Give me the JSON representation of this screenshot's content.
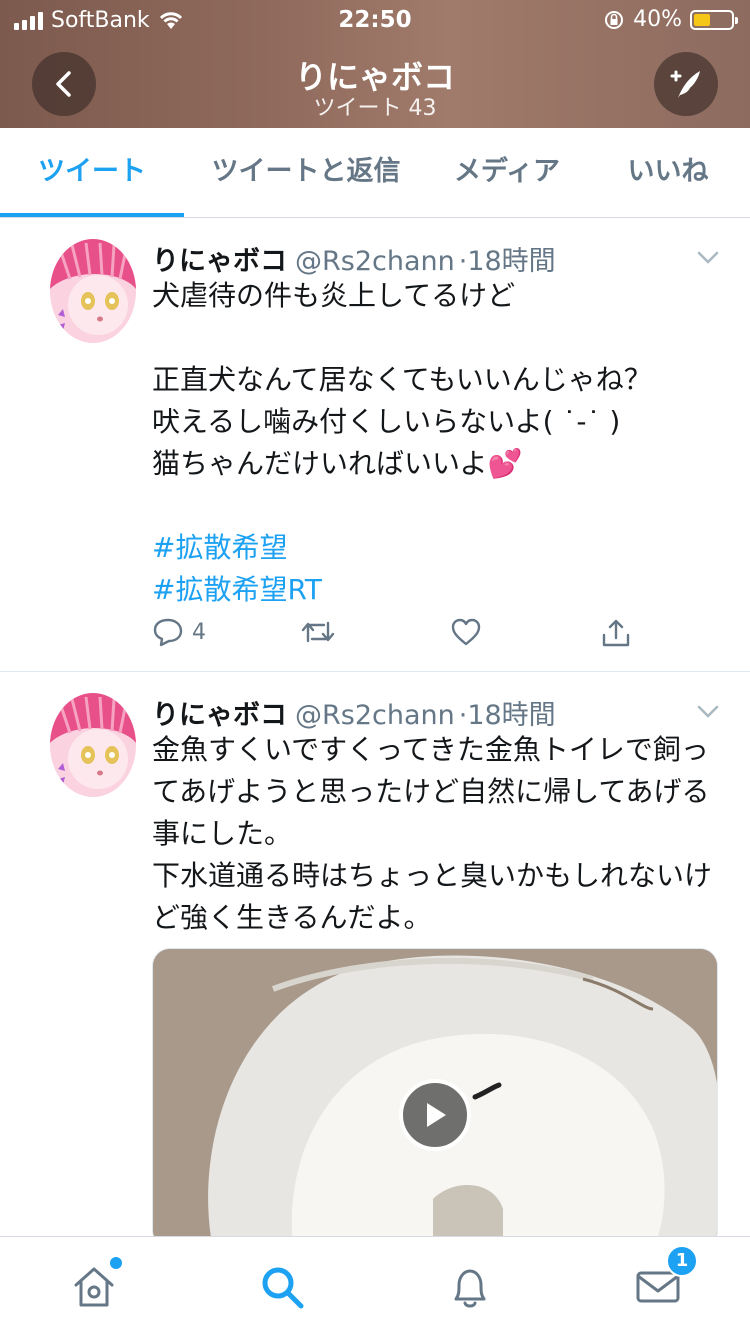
{
  "status_bar": {
    "carrier": "SoftBank",
    "time": "22:50",
    "battery": "40%",
    "battery_level": 0.4
  },
  "header": {
    "title": "りにゃボコ",
    "subtitle": "ツイート 43",
    "back_icon": "chevron-left-icon",
    "compose_icon": "compose-tweet-icon"
  },
  "tabs": [
    {
      "label": "ツイート",
      "active": true
    },
    {
      "label": "ツイートと返信",
      "active": false
    },
    {
      "label": "メディア",
      "active": false
    },
    {
      "label": "いいね",
      "active": false
    }
  ],
  "tweets": [
    {
      "name": "りにゃボコ",
      "handle": "@Rs2chann",
      "time": "·18時間",
      "lines": [
        "犬虐待の件も炎上してるけど",
        "",
        "正直犬なんて居なくてもいいんじゃね？",
        "吠えるし噛み付くしいらないよ( ˙-˙ )",
        "猫ちゃんだけいればいいよ💕"
      ],
      "hashtags": [
        "#拡散希望",
        "#拡散希望RT"
      ],
      "reply_count": "4"
    },
    {
      "name": "りにゃボコ",
      "handle": "@Rs2chann",
      "time": "·18時間",
      "text": "金魚すくいですくってきた金魚トイレで飼ってあげようと思ったけど自然に帰してあげる事にした。\n下水道通る時はちょっと臭いかもしれないけど強く生きるんだよ。"
    }
  ],
  "bottom_nav": {
    "items": [
      "home-icon",
      "search-icon",
      "notifications-icon",
      "messages-icon"
    ],
    "messages_badge": "1",
    "accent": "#1da1f2"
  }
}
